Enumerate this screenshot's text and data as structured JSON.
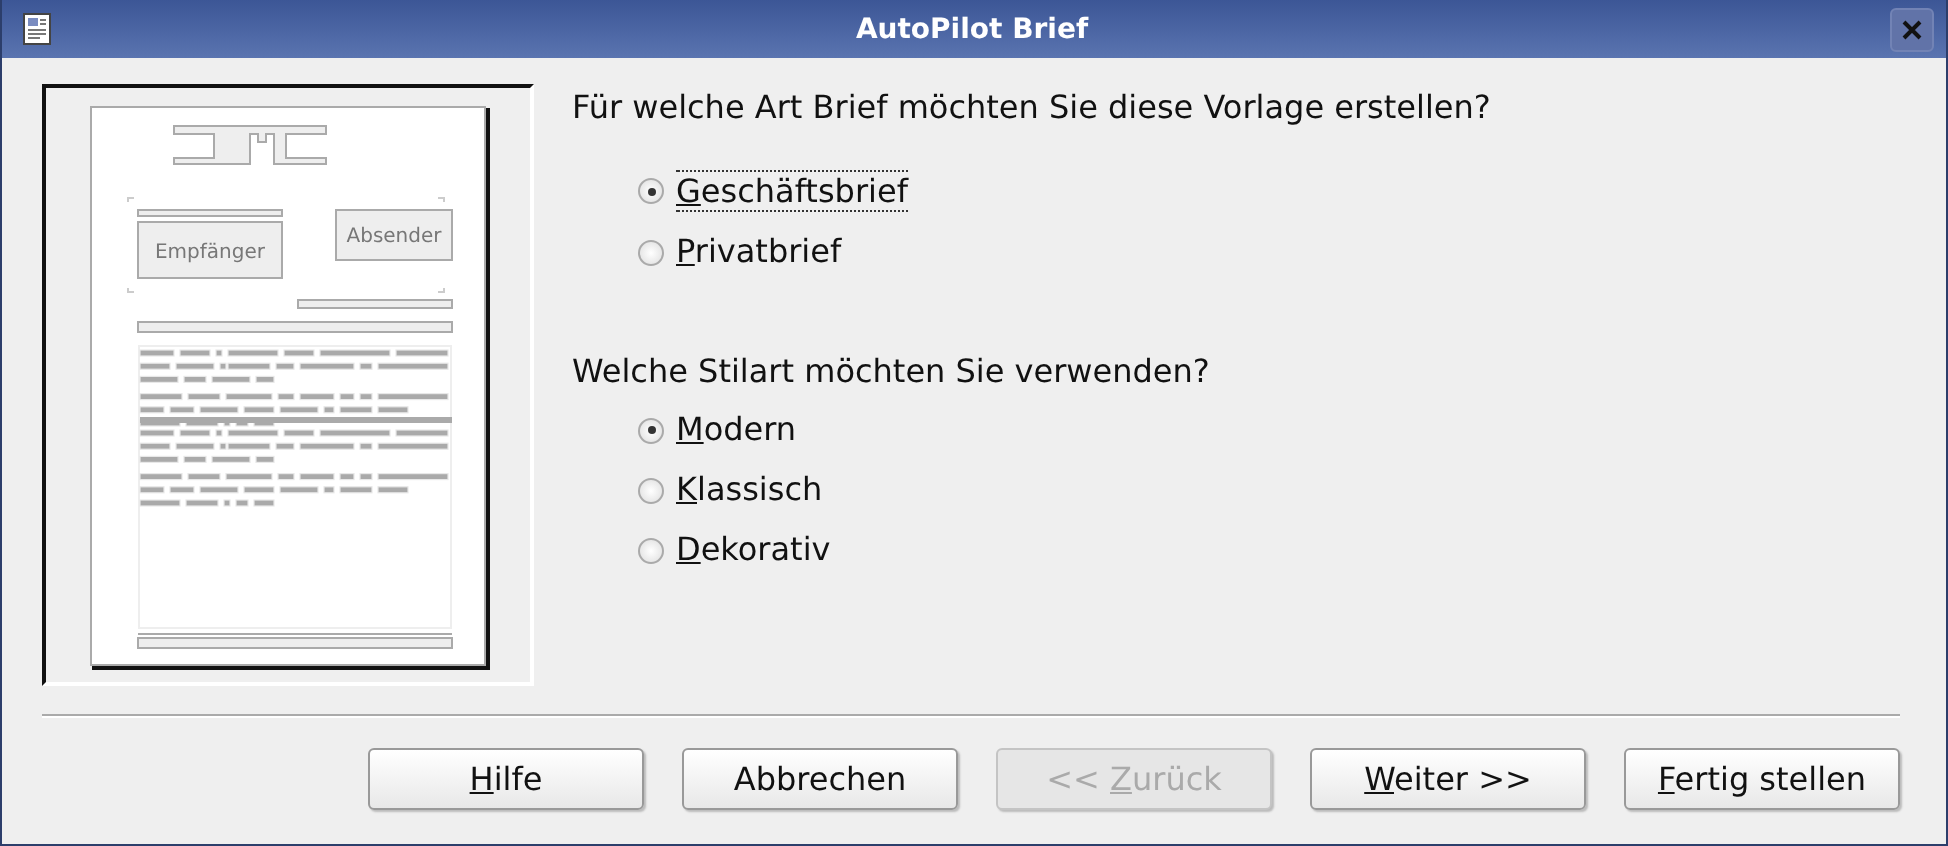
{
  "window": {
    "title": "AutoPilot Brief"
  },
  "preview": {
    "recipient": "Empfänger",
    "sender": "Absender"
  },
  "groups": [
    {
      "question": "Für welche Art Brief möchten Sie diese Vorlage erstellen?",
      "options": [
        {
          "key": "G",
          "rest": "eschäftsbrief",
          "selected": true,
          "focused": true
        },
        {
          "key": "P",
          "rest": "rivatbrief",
          "selected": false,
          "focused": false
        }
      ]
    },
    {
      "question": "Welche Stilart möchten Sie verwenden?",
      "options": [
        {
          "key": "M",
          "rest": "odern",
          "selected": true,
          "focused": false
        },
        {
          "key": "K",
          "rest": "lassisch",
          "selected": false,
          "focused": false
        },
        {
          "key": "D",
          "rest": "ekorativ",
          "selected": false,
          "focused": false
        }
      ]
    }
  ],
  "buttons": [
    {
      "key": "H",
      "rest": "ilfe",
      "disabled": false
    },
    {
      "before": "Abbrechen",
      "disabled": false
    },
    {
      "before": "<< ",
      "key": "Z",
      "rest": "urück",
      "disabled": true
    },
    {
      "key": "W",
      "rest": "eiter >>",
      "disabled": false
    },
    {
      "key": "F",
      "rest": "ertig stellen",
      "disabled": false
    }
  ]
}
